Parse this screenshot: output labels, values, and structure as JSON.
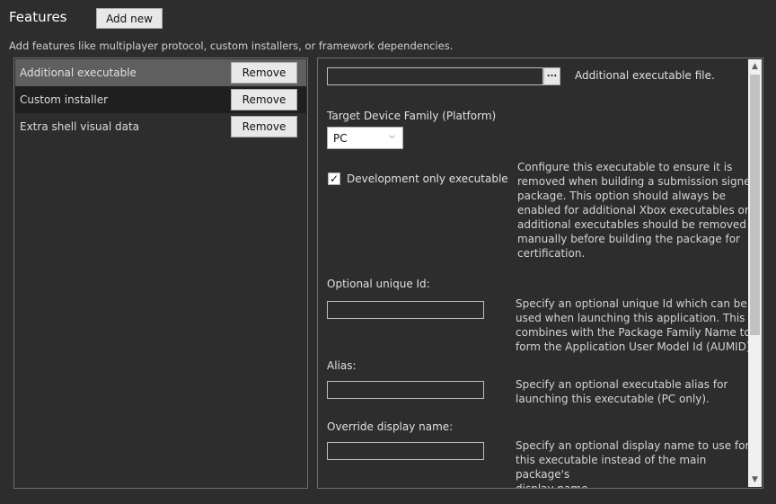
{
  "header": {
    "title": "Features",
    "add_button": "Add new",
    "subtitle": "Add features like multiplayer protocol, custom installers, or framework dependencies."
  },
  "features": [
    {
      "label": "Additional executable",
      "remove": "Remove"
    },
    {
      "label": "Custom installer",
      "remove": "Remove"
    },
    {
      "label": "Extra shell visual data",
      "remove": "Remove"
    }
  ],
  "details": {
    "exe_path_value": "",
    "browse_label": "...",
    "exe_desc": "Additional executable file.",
    "platform_label": "Target Device Family (Platform)",
    "platform_value": "PC",
    "dev_only_label": "Development only executable",
    "dev_only_checked": true,
    "dev_only_desc": [
      "Configure this executable to ensure it is",
      "removed when building a submission signed",
      "package. This option should always be",
      "enabled for additional Xbox executables or",
      "additional executables should be removed",
      "manually before building the package for",
      "certification."
    ],
    "unique_id_label": "Optional unique Id:",
    "unique_id_value": "",
    "unique_id_desc": [
      "Specify an optional unique Id which can be",
      "used when launching this application. This Id",
      "combines with the Package Family Name to",
      "form the Application User Model Id (AUMID)."
    ],
    "alias_label": "Alias:",
    "alias_value": "",
    "alias_desc": [
      "Specify an optional executable alias for",
      "launching this executable (PC only)."
    ],
    "display_name_label": "Override display name:",
    "display_name_value": "",
    "display_name_desc": [
      "Specify an optional display name to use for",
      "this executable instead of the main package's",
      "display name."
    ]
  },
  "colors": {
    "background": "#2d2d2d",
    "selected_row": "#5f5f5f",
    "dark_row": "#1f1f1f",
    "border": "#6e6e6e"
  },
  "icons": {
    "dropdown": "chevron-down-icon",
    "checkbox": "checkmark-icon",
    "scroll_up": "scroll-up-arrow-icon",
    "scroll_down": "scroll-down-arrow-icon"
  }
}
